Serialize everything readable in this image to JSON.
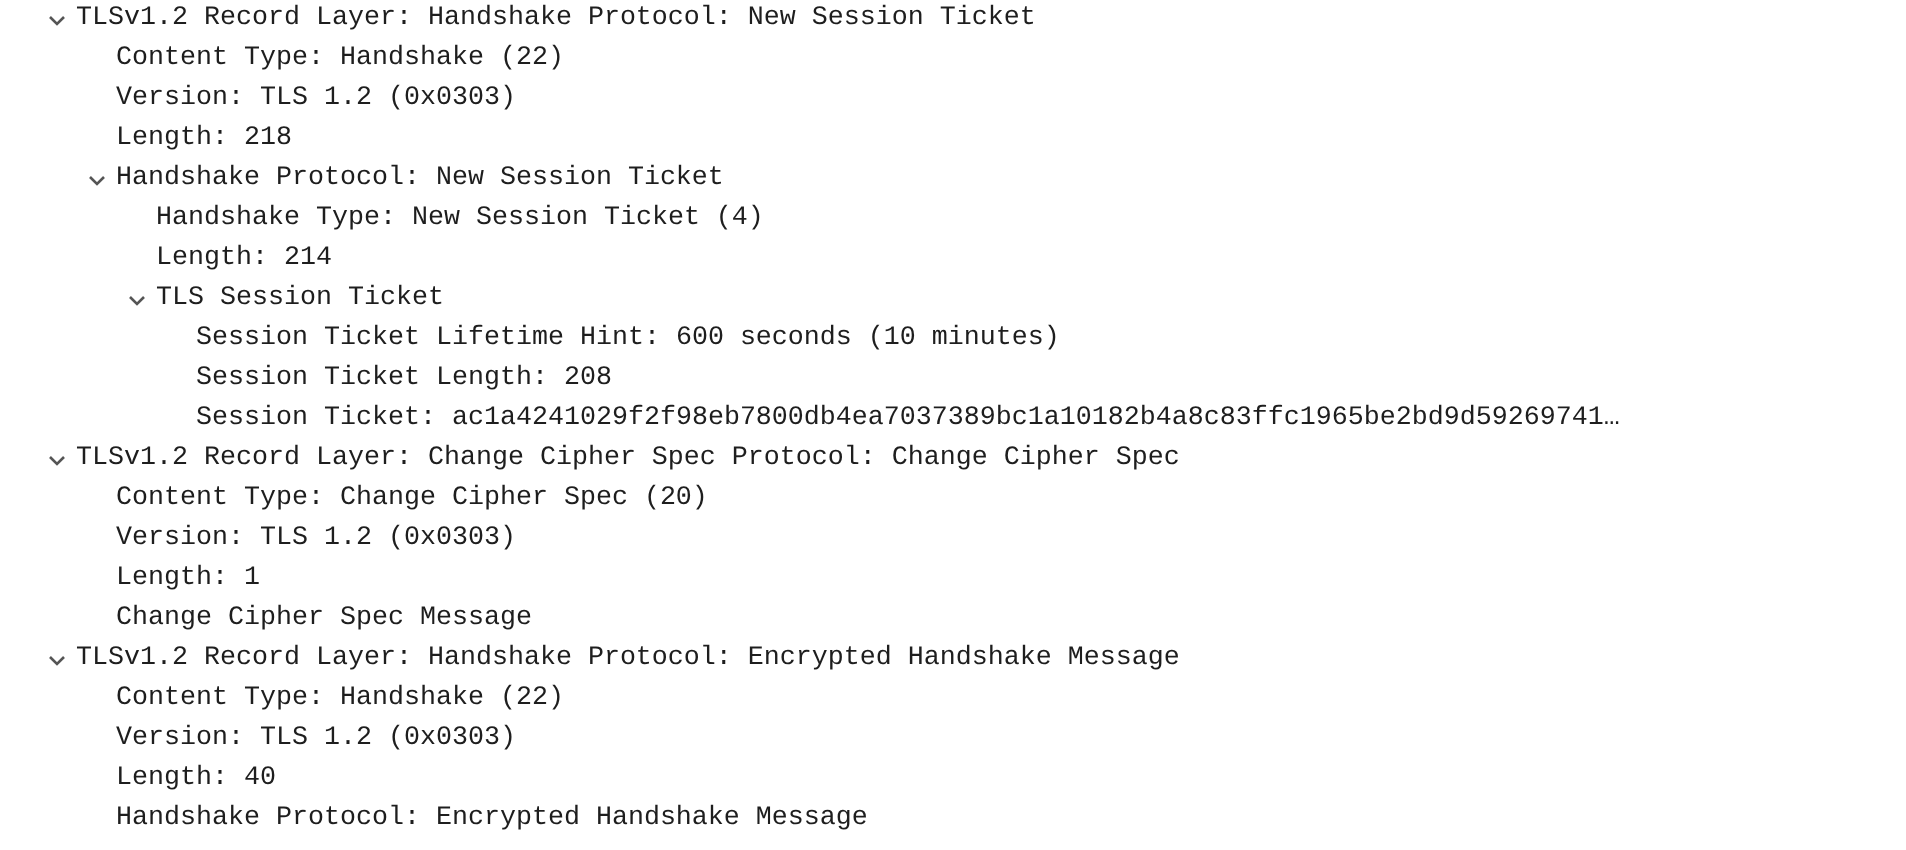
{
  "tree": [
    {
      "text": "TLSv1.2 Record Layer: Handshake Protocol: New Session Ticket",
      "expanded": true,
      "children": [
        {
          "text": "Content Type: Handshake (22)"
        },
        {
          "text": "Version: TLS 1.2 (0x0303)"
        },
        {
          "text": "Length: 218"
        },
        {
          "text": "Handshake Protocol: New Session Ticket",
          "expanded": true,
          "children": [
            {
              "text": "Handshake Type: New Session Ticket (4)"
            },
            {
              "text": "Length: 214"
            },
            {
              "text": "TLS Session Ticket",
              "expanded": true,
              "children": [
                {
                  "text": "Session Ticket Lifetime Hint: 600 seconds (10 minutes)"
                },
                {
                  "text": "Session Ticket Length: 208"
                },
                {
                  "text": "Session Ticket: ac1a4241029f2f98eb7800db4ea7037389bc1a10182b4a8c83ffc1965be2bd9d59269741…"
                }
              ]
            }
          ]
        }
      ]
    },
    {
      "text": "TLSv1.2 Record Layer: Change Cipher Spec Protocol: Change Cipher Spec",
      "expanded": true,
      "children": [
        {
          "text": "Content Type: Change Cipher Spec (20)"
        },
        {
          "text": "Version: TLS 1.2 (0x0303)"
        },
        {
          "text": "Length: 1"
        },
        {
          "text": "Change Cipher Spec Message"
        }
      ]
    },
    {
      "text": "TLSv1.2 Record Layer: Handshake Protocol: Encrypted Handshake Message",
      "expanded": true,
      "children": [
        {
          "text": "Content Type: Handshake (22)"
        },
        {
          "text": "Version: TLS 1.2 (0x0303)"
        },
        {
          "text": "Length: 40"
        },
        {
          "text": "Handshake Protocol: Encrypted Handshake Message"
        }
      ]
    }
  ]
}
